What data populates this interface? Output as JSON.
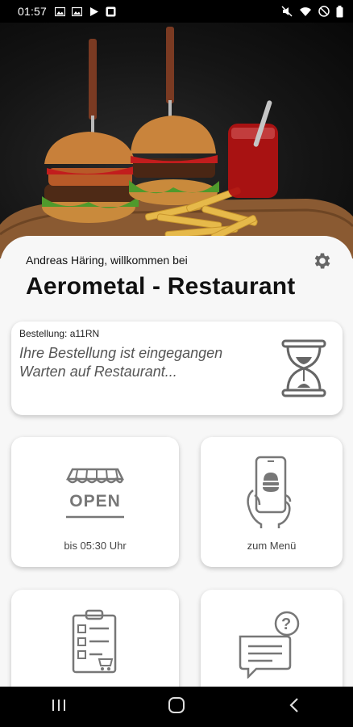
{
  "status_bar": {
    "time": "01:57",
    "left_icons": [
      "gallery-icon",
      "gallery-icon",
      "play-store-icon",
      "app-icon"
    ],
    "right_icons": [
      "mute-icon",
      "wifi-icon",
      "do-not-disturb-icon",
      "battery-icon"
    ]
  },
  "header": {
    "greeting": "Andreas Häring, willkommen bei",
    "restaurant_name": "Aerometal - Restaurant"
  },
  "order": {
    "label": "Bestellung: a11RN",
    "status_line_1": "Ihre Bestellung ist eingegangen",
    "status_line_2": "Warten auf Restaurant..."
  },
  "tiles": {
    "open_sign": "OPEN",
    "open_caption": "bis 05:30 Uhr",
    "menu_caption": "zum Menü"
  },
  "colors": {
    "background": "#f7f7f7",
    "card": "#ffffff",
    "icon_gray": "#777777"
  }
}
